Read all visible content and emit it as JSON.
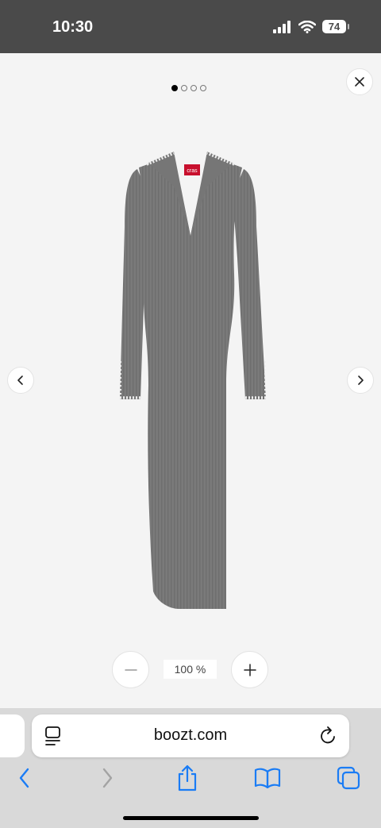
{
  "status_bar": {
    "time": "10:30",
    "battery": "74"
  },
  "gallery": {
    "image_count": 4,
    "active_index": 0,
    "image_alt": "Grey knit dress with pearl-trimmed collar",
    "brand_tag": "cras"
  },
  "zoom": {
    "level": "100 %"
  },
  "browser": {
    "url": "boozt.com"
  },
  "colors": {
    "status_bar": "#4a4a4a",
    "background": "#f4f4f4",
    "toolbar_blue": "#1a7cf5",
    "dress_grey": "#777777"
  }
}
